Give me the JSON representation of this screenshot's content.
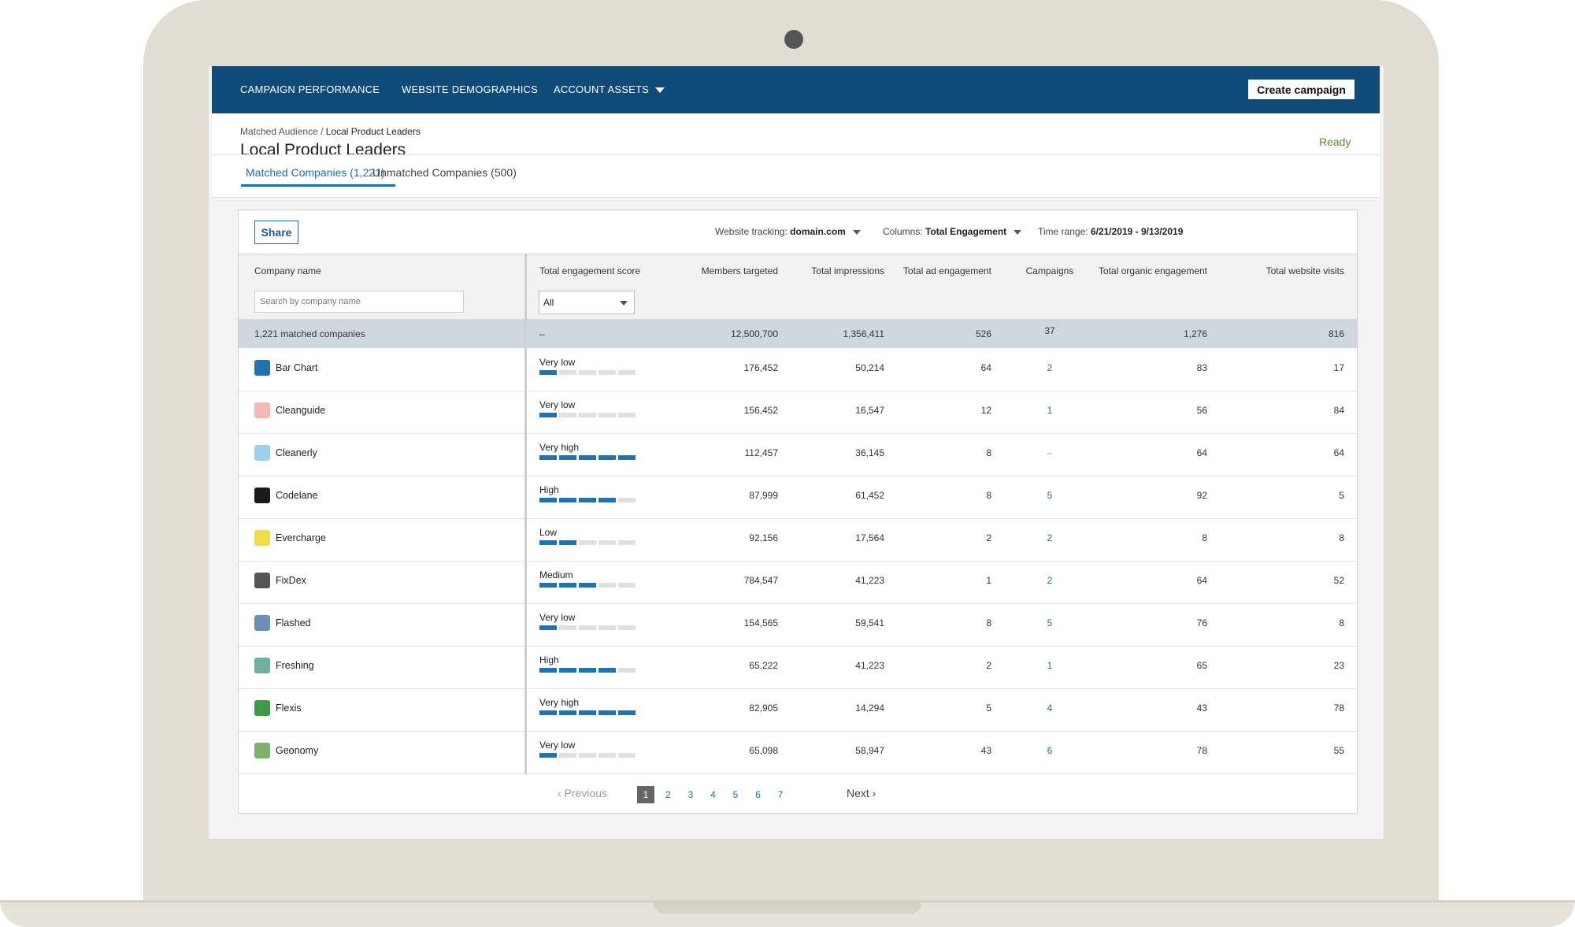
{
  "nav": {
    "items": [
      "CAMPAIGN PERFORMANCE",
      "WEBSITE DEMOGRAPHICS",
      "ACCOUNT ASSETS"
    ],
    "create_label": "Create campaign"
  },
  "header": {
    "crumb_parent": "Matched Audience",
    "crumb_sep": " / ",
    "crumb_current": "Local Product Leaders",
    "title": "Local Product Leaders",
    "status": "Ready"
  },
  "tabs": [
    "Matched Companies (1,221)",
    "Unmatched Companies (500)"
  ],
  "toolbar": {
    "share_label": "Share",
    "tracking_label": "Website tracking:",
    "tracking_value": "domain.com",
    "columns_label": "Columns:",
    "columns_value": "Total Engagement",
    "time_label": "Time range:",
    "time_value": "6/21/2019 - 9/13/2019"
  },
  "columns": [
    "Company name",
    "Total engagement score",
    "Members targeted",
    "Total impressions",
    "Total ad engagement",
    "Campaigns",
    "Total organic engagement",
    "Total website visits"
  ],
  "filters": {
    "search_placeholder": "Search by company name",
    "score_select": "All"
  },
  "summary": {
    "label": "1,221 matched companies",
    "score": "–",
    "members": "12,500,700",
    "impressions": "1,356,411",
    "ad_engagement": "526",
    "campaigns": "37",
    "organic": "1,276",
    "visits": "816"
  },
  "rows": [
    {
      "name": "Bar Chart",
      "logo_color": "#1f73b0",
      "score_label": "Very low",
      "score_level": 1,
      "members": "176,452",
      "impressions": "50,214",
      "ad": "64",
      "campaigns": "2",
      "organic": "83",
      "visits": "17"
    },
    {
      "name": "Cleanguide",
      "logo_color": "#f4b6b6",
      "score_label": "Very low",
      "score_level": 1,
      "members": "156,452",
      "impressions": "16,547",
      "ad": "12",
      "campaigns": "1",
      "organic": "56",
      "visits": "84"
    },
    {
      "name": "Cleanerly",
      "logo_color": "#9fd0ea",
      "score_label": "Very high",
      "score_level": 5,
      "members": "112,457",
      "impressions": "36,145",
      "ad": "8",
      "campaigns": "–",
      "organic": "64",
      "visits": "64"
    },
    {
      "name": "Codelane",
      "logo_color": "#1a1a1a",
      "score_label": "High",
      "score_level": 4,
      "members": "87,999",
      "impressions": "61,452",
      "ad": "8",
      "campaigns": "5",
      "organic": "92",
      "visits": "5"
    },
    {
      "name": "Evercharge",
      "logo_color": "#f2dc4a",
      "score_label": "Low",
      "score_level": 2,
      "members": "92,156",
      "impressions": "17,564",
      "ad": "2",
      "campaigns": "2",
      "organic": "8",
      "visits": "8"
    },
    {
      "name": "FixDex",
      "logo_color": "#555555",
      "score_label": "Medium",
      "score_level": 3,
      "members": "784,547",
      "impressions": "41,223",
      "ad": "1",
      "campaigns": "2",
      "organic": "64",
      "visits": "52"
    },
    {
      "name": "Flashed",
      "logo_color": "#6b8fb8",
      "score_label": "Very low",
      "score_level": 1,
      "members": "154,565",
      "impressions": "59,541",
      "ad": "8",
      "campaigns": "5",
      "organic": "76",
      "visits": "8"
    },
    {
      "name": "Freshing",
      "logo_color": "#6fb0a0",
      "score_label": "High",
      "score_level": 4,
      "members": "65,222",
      "impressions": "41,223",
      "ad": "2",
      "campaigns": "1",
      "organic": "65",
      "visits": "23"
    },
    {
      "name": "Flexis",
      "logo_color": "#3c9a48",
      "score_label": "Very high",
      "score_level": 5,
      "members": "82,905",
      "impressions": "14,294",
      "ad": "5",
      "campaigns": "4",
      "organic": "43",
      "visits": "78"
    },
    {
      "name": "Geonomy",
      "logo_color": "#7bb36b",
      "score_label": "Very low",
      "score_level": 1,
      "members": "65,098",
      "impressions": "58,947",
      "ad": "43",
      "campaigns": "6",
      "organic": "78",
      "visits": "55"
    }
  ],
  "pagination": {
    "prev": "‹ Previous",
    "next": "Next ›",
    "pages": [
      "1",
      "2",
      "3",
      "4",
      "5",
      "6",
      "7"
    ],
    "current": "1"
  }
}
